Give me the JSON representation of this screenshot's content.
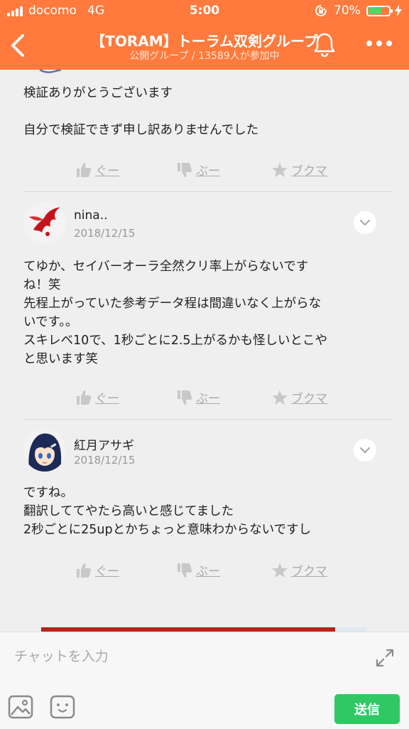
{
  "status_bar": {
    "carrier": "docomo",
    "network": "4G",
    "time": "5:00",
    "battery_pct": "70%",
    "battery_level": 0.7,
    "icons": [
      "signal-bars-icon",
      "rotation-lock-icon",
      "battery-icon",
      "charging-bolt-icon"
    ]
  },
  "header": {
    "title": "【TORAM】トーラム双剣グループ",
    "subtitle": "公開グループ / 13589人が参加中",
    "icons": [
      "back-chevron-icon",
      "bell-icon",
      "more-dots-icon"
    ]
  },
  "action_labels": {
    "good": "ぐー",
    "boo": "ぶー",
    "bookmark": "ブクマ"
  },
  "messages": [
    {
      "lines": [
        "検証ありがとうございます",
        "",
        "自分で検証できず申し訳ありませんでした"
      ]
    },
    {
      "username": "nina..",
      "date": "2018/12/15",
      "lines": [
        "てゆか、セイバーオーラ全然クリ率上がらないです",
        "ね！笑",
        "先程上がっていた参考データ程は間違いなく上がらな",
        "いです。。",
        "スキレベ10で、1秒ごとに2.5上がるかも怪しいとこや",
        "と思います笑"
      ]
    },
    {
      "username": "紅月アサギ",
      "date": "2018/12/15",
      "lines": [
        "ですね。",
        "翻訳しててやたら高いと感じてました",
        "2秒ごとに25upとかちょっと意味わからないですし"
      ]
    }
  ],
  "input_bar": {
    "placeholder": "チャットを入力",
    "send_label": "送信",
    "icons": [
      "expand-icon",
      "image-icon",
      "emoji-icon"
    ]
  },
  "colors": {
    "header": "#ff7a3c",
    "send": "#2fc862",
    "background": "#efefef",
    "battery_fill": "#4cd964"
  }
}
